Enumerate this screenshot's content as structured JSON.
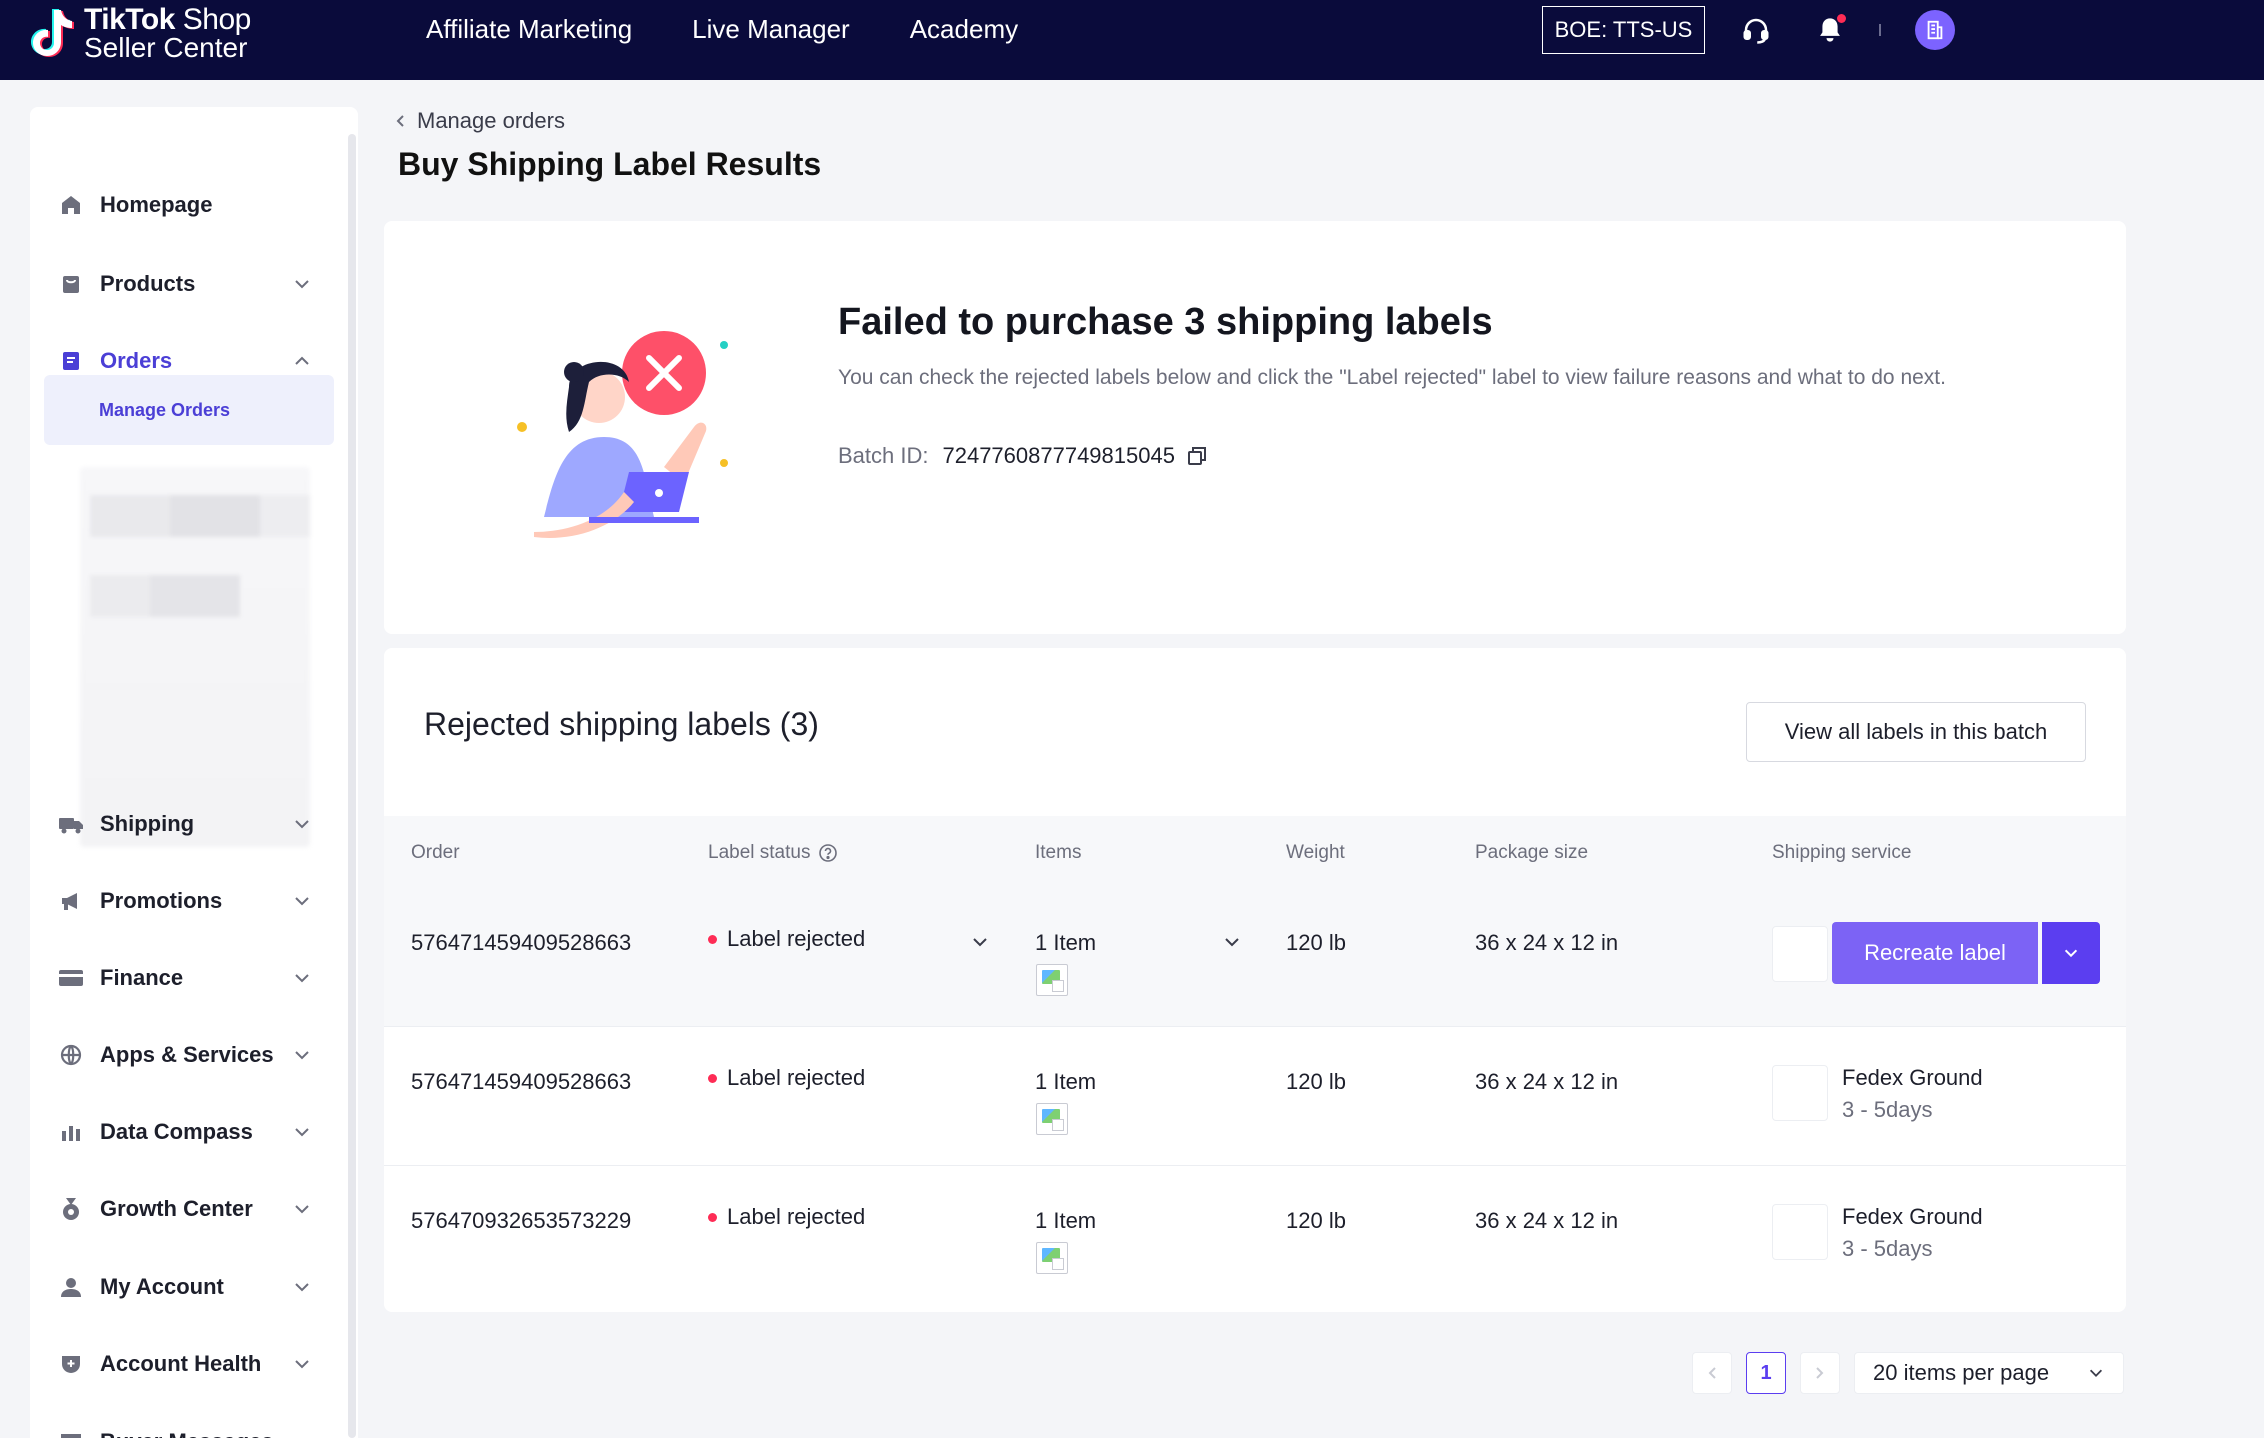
{
  "app": {
    "logo_line1_bold": "TikTok",
    "logo_line1_rest": " Shop",
    "logo_line2": "Seller Center"
  },
  "topnav": {
    "items": [
      "Affiliate Marketing",
      "Live Manager",
      "Academy"
    ],
    "region": "BOE: TTS-US"
  },
  "icons": {
    "headset": "headset-icon",
    "bell": "bell-icon",
    "avatar": "building-icon"
  },
  "colors": {
    "topbar": "#0a0b3b",
    "accent": "#7c63f5",
    "accent_dark": "#5b3ef0",
    "danger": "#fe2c55"
  },
  "sidebar": {
    "items": [
      {
        "label": "Homepage",
        "icon": "home-icon"
      },
      {
        "label": "Products",
        "icon": "bag-icon"
      },
      {
        "label": "Orders",
        "icon": "orders-icon"
      },
      {
        "label": "Shipping",
        "icon": "truck-icon"
      },
      {
        "label": "Promotions",
        "icon": "megaphone-icon"
      },
      {
        "label": "Finance",
        "icon": "card-icon"
      },
      {
        "label": "Apps & Services",
        "icon": "globe-icon"
      },
      {
        "label": "Data Compass",
        "icon": "chart-icon"
      },
      {
        "label": "Growth Center",
        "icon": "medal-icon"
      },
      {
        "label": "My Account",
        "icon": "user-icon"
      },
      {
        "label": "Account Health",
        "icon": "shield-icon"
      },
      {
        "label": "Buyer Messages",
        "icon": "chat-icon"
      }
    ],
    "sub_item": "Manage Orders"
  },
  "breadcrumb": "Manage orders",
  "page_title": "Buy Shipping Label Results",
  "failure": {
    "title": "Failed to purchase 3 shipping labels",
    "description": "You can check the rejected labels below and click the \"Label rejected\" label to view failure reasons and what to do next.",
    "batch_label": "Batch ID:",
    "batch_id": "7247760877749815045"
  },
  "rejected": {
    "title": "Rejected shipping labels (3)",
    "view_all": "View all labels in this batch",
    "columns": [
      "Order",
      "Label status",
      "Items",
      "Weight",
      "Package size",
      "Shipping service"
    ],
    "rows": [
      {
        "order": "576471459409528663",
        "status": "Label rejected",
        "items": "1 Item",
        "weight": "120 lb",
        "size": "36 x 24 x 12 in",
        "action": "Recreate label"
      },
      {
        "order": "576471459409528663",
        "status": "Label rejected",
        "items": "1 Item",
        "weight": "120 lb",
        "size": "36 x 24 x 12 in",
        "service": "Fedex Ground",
        "days": "3 - 5days"
      },
      {
        "order": "576470932653573229",
        "status": "Label rejected",
        "items": "1 Item",
        "weight": "120 lb",
        "size": "36 x 24 x 12 in",
        "service": "Fedex Ground",
        "days": "3 - 5days"
      }
    ]
  },
  "pagination": {
    "current_page": "1",
    "per_page": "20 items per page"
  }
}
